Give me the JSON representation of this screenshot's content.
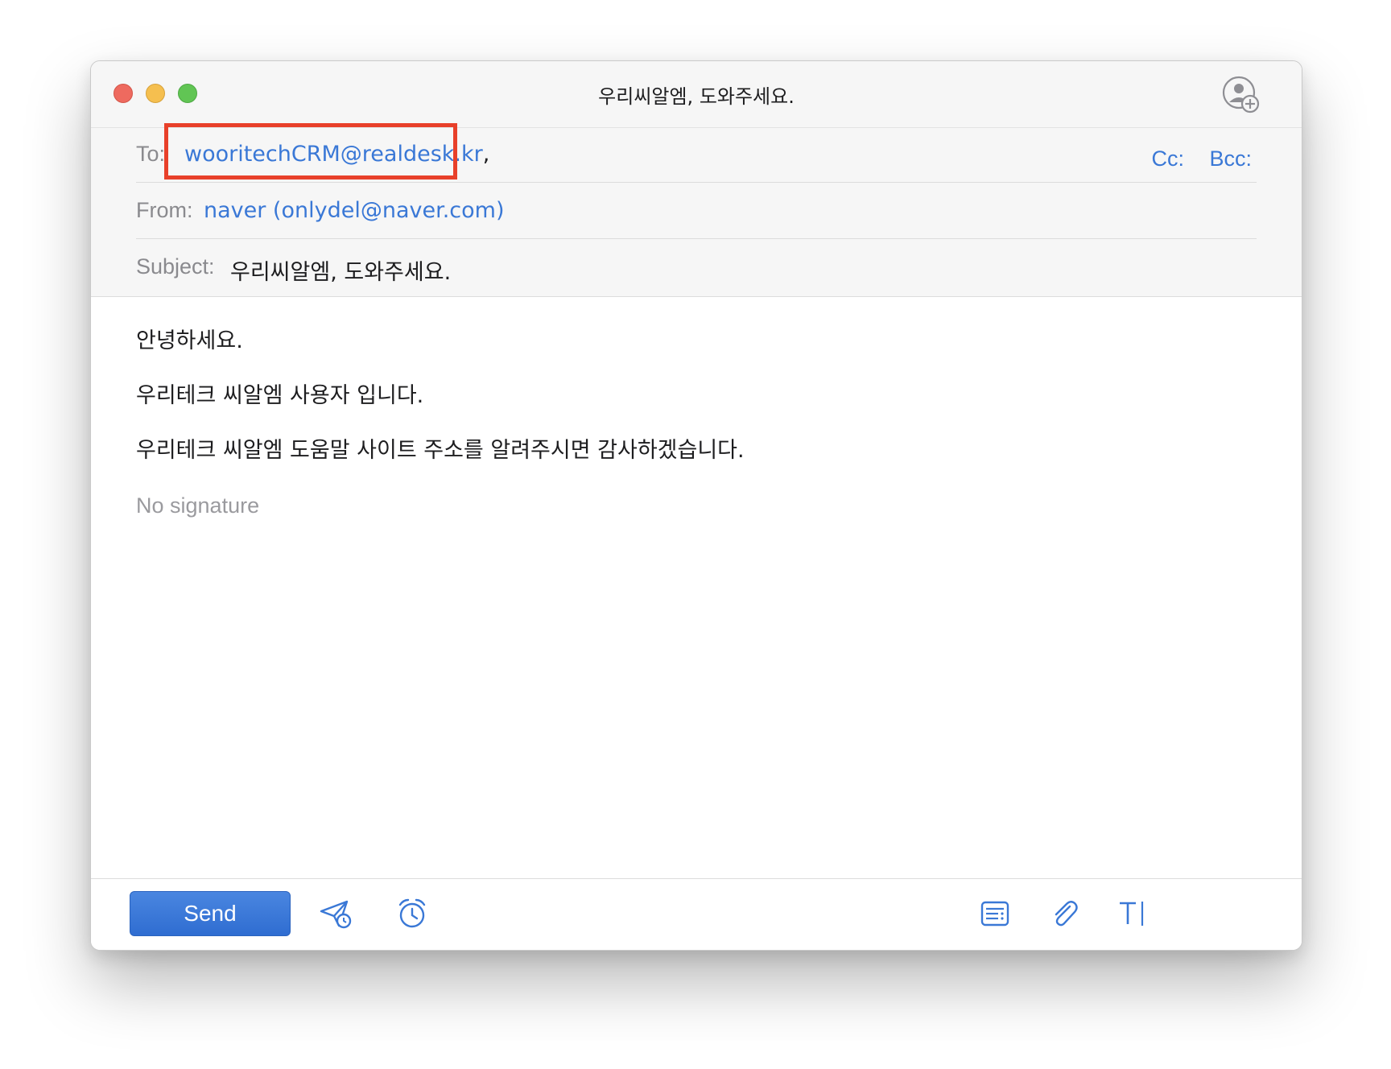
{
  "window": {
    "title": "우리씨알엠, 도와주세요."
  },
  "fields": {
    "to_label": "To:",
    "to_value": "wooritechCRM@realdesk.kr",
    "to_separator": ",",
    "cc_label": "Cc:",
    "bcc_label": "Bcc:",
    "from_label": "From:",
    "from_value": "naver (onlydel@naver.com)",
    "subject_label": "Subject:",
    "subject_value": "우리씨알엠, 도와주세요."
  },
  "body": {
    "lines": [
      "안녕하세요.",
      "우리테크 씨알엠 사용자 입니다.",
      "우리테크 씨알엠 도움말 사이트 주소를 알려주시면 감사하겠습니다."
    ],
    "signature": "No signature"
  },
  "footer": {
    "send_label": "Send"
  },
  "icons": {
    "add_contact": "add-contact-icon",
    "send_later": "send-later-icon",
    "remind": "alarm-clock-icon",
    "template": "template-icon",
    "attach": "paperclip-icon",
    "format": "text-format-icon"
  },
  "colors": {
    "accent": "#3a78d6",
    "highlight": "#e8402a",
    "send_button": "#2f6dd1"
  }
}
